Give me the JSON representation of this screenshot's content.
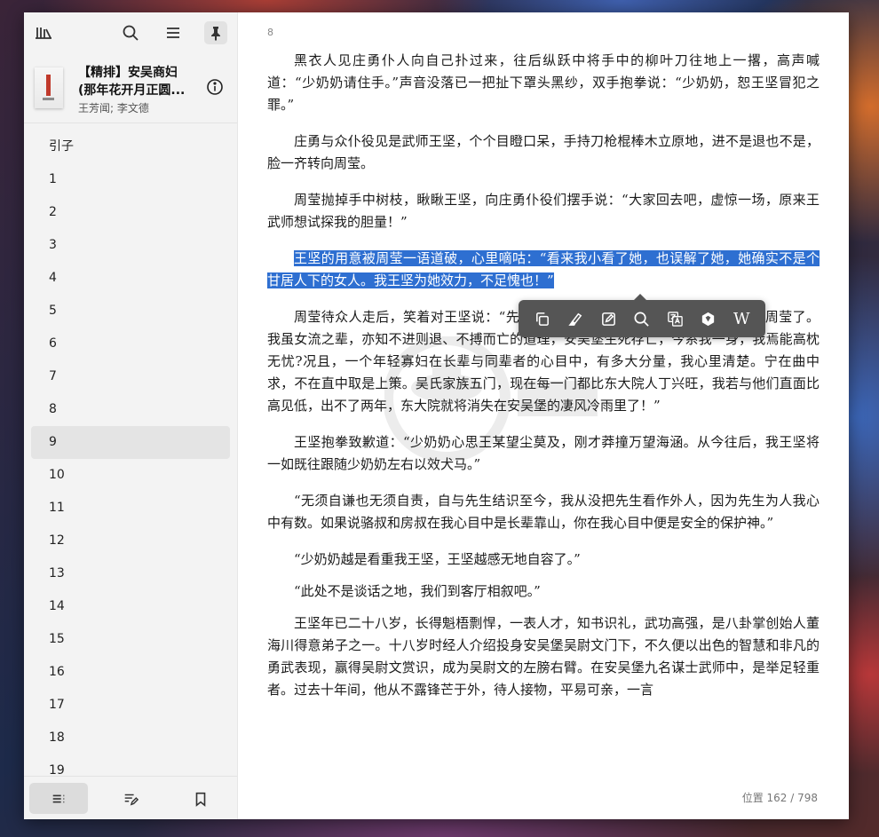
{
  "sidebar": {
    "book": {
      "title": "【精排】安吴商妇",
      "subtitle": "(那年花开月正圆...",
      "author": "王芳闻; 李文德"
    },
    "toc": [
      "引子",
      "1",
      "2",
      "3",
      "4",
      "5",
      "6",
      "7",
      "8",
      "9",
      "10",
      "11",
      "12",
      "13",
      "14",
      "15",
      "16",
      "17",
      "18",
      "19"
    ],
    "active_index": 9
  },
  "icons": {
    "library": "library-icon",
    "search": "search-icon",
    "menu": "menu-icon",
    "pin": "pin-icon",
    "info": "info-icon",
    "toc_tab": "toc-list-icon",
    "annotations_tab": "annotations-icon",
    "bookmarks_tab": "bookmark-icon"
  },
  "reader": {
    "page_number": "8",
    "paragraphs": [
      "黑衣人见庄勇仆人向自己扑过来，往后纵跃中将手中的柳叶刀往地上一撂，高声喊道：“少奶奶请住手。”声音没落已一把扯下罩头黑纱，双手抱拳说：“少奶奶，恕王坚冒犯之罪。”",
      "庄勇与众仆役见是武师王坚，个个目瞪口呆，手持刀枪棍棒木立原地，进不是退也不是，脸一齐转向周莹。",
      "周莹抛掉手中树枝，瞅瞅王坚，向庄勇仆役们摆手说：“大家回去吧，虚惊一场，原来王武师想试探我的胆量！”",
      "王坚的用意被周莹一语道破，心里嘀咕：“看来我小看了她，也误解了她，她确实不是个甘居人下的女人。我王坚为她效力，不足愧也！”",
      "周莹待众人走后，笑着对王坚说：“先生试探我的胆量，用心良苦，但你小视我周莹了。我虽女流之辈，亦知不进则退、不搏而亡的道理，安吴堡生死存亡，今系我一身，我焉能高枕无忧?况且，一个年轻寡妇在长辈与同辈者的心目中，有多大分量，我心里清楚。宁在曲中求，不在直中取是上策。吴氏家族五门，现在每一门都比东大院人丁兴旺，我若与他们直面比高见低，出不了两年，东大院就将消失在安吴堡的凄风冷雨里了！”",
      "王坚抱拳致歉道：“少奶奶心思王某望尘莫及，刚才莽撞万望海涵。从今往后，我王坚将一如既往跟随少奶奶左右以效犬马。”",
      "“无须自谦也无须自责，自与先生结识至今，我从没把先生看作外人，因为先生为人我心中有数。如果说骆叔和房叔在我心目中是长辈靠山，你在我心目中便是安全的保护神。”",
      "“少奶奶越是看重我王坚，王坚越感无地自容了。”",
      "“此处不是谈话之地，我们到客厅相叙吧。”",
      "王坚年已二十八岁，长得魁梧剽悍，一表人才，知书识礼，武功高强，是八卦掌创始人董海川得意弟子之一。十八岁时经人介绍投身安吴堡吴尉文门下，不久便以出色的智慧和非凡的勇武表现，赢得吴尉文赏识，成为吴尉文的左膀右臂。在安吴堡九名谋士武师中，是举足轻重者。过去十年间，他从不露锋芒于外，待人接物，平易可亲，一言"
    ],
    "highlighted_paragraph": 3,
    "location": "位置 162 / 798"
  },
  "selection_toolbar": {
    "actions": [
      "copy",
      "highlight",
      "note",
      "search",
      "translate",
      "dictionary",
      "wikipedia"
    ],
    "wikipedia_label": "W"
  },
  "colors": {
    "selection": "#2e6fd1",
    "toolbar_bg": "#555555",
    "sidebar_bg": "#f3f3f3"
  }
}
